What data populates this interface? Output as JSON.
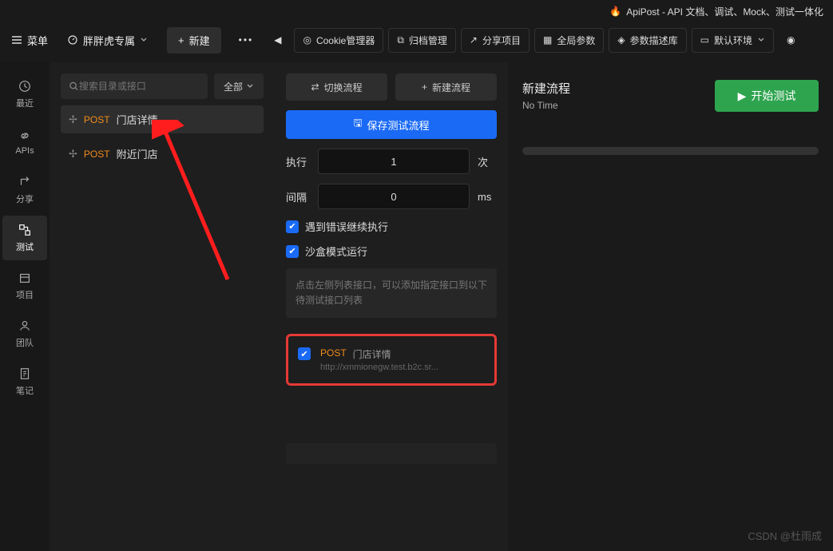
{
  "title": "ApiPost - API 文档、调试、Mock、测试一体化",
  "topbar": {
    "menu": "菜单",
    "workspace": "胖胖虎专属",
    "new_label": "新建",
    "tools": {
      "cookie": "Cookie管理器",
      "archive": "归档管理",
      "share": "分享项目",
      "globals": "全局参数",
      "params_lib": "参数描述库",
      "env": "默认环境"
    }
  },
  "sidebar": {
    "items": [
      {
        "label": "最近"
      },
      {
        "label": "APIs"
      },
      {
        "label": "分享"
      },
      {
        "label": "测试"
      },
      {
        "label": "项目"
      },
      {
        "label": "团队"
      },
      {
        "label": "笔记"
      }
    ]
  },
  "list": {
    "search_placeholder": "搜索目录或接口",
    "filter": "全部",
    "apis": [
      {
        "method": "POST",
        "name": "门店详情",
        "active": true
      },
      {
        "method": "POST",
        "name": "附近门店",
        "active": false
      }
    ]
  },
  "flow": {
    "switch": "切换流程",
    "new": "新建流程",
    "save": "保存测试流程",
    "exec_label": "执行",
    "exec_value": "1",
    "exec_unit": "次",
    "interval_label": "间隔",
    "interval_value": "0",
    "interval_unit": "ms",
    "continue_on_error": "遇到错误继续执行",
    "sandbox": "沙盒模式运行",
    "hint": "点击左侧列表接口，可以添加指定接口到以下待测试接口列表",
    "test_item": {
      "method": "POST",
      "name": "门店详情",
      "url": "http://xmmionegw.test.b2c.sr..."
    }
  },
  "result": {
    "title": "新建流程",
    "subtitle": "No Time",
    "start": "开始测试"
  },
  "watermark": "CSDN @杜雨成"
}
